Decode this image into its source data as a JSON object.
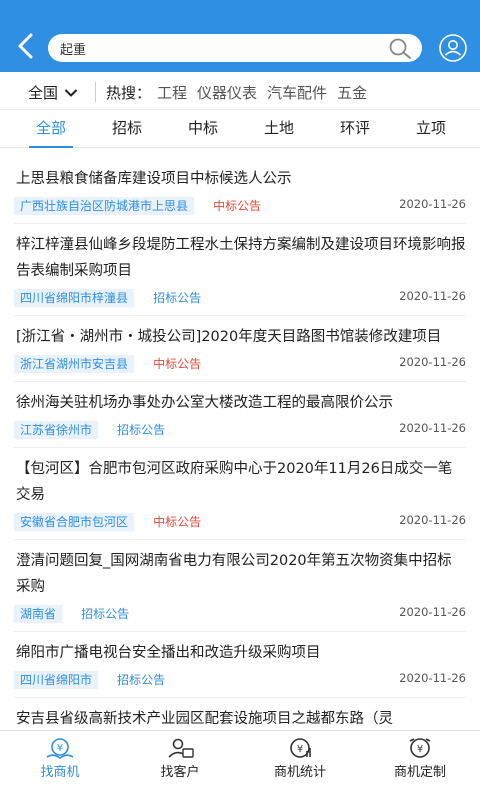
{
  "header": {
    "search_value": "起重",
    "colors": {
      "bar": "#2f8fe3"
    }
  },
  "filter": {
    "region": "全国",
    "hot_label": "热搜：",
    "hot_items": [
      "工程",
      "仪器仪表",
      "汽车配件",
      "五金"
    ]
  },
  "tabs": [
    {
      "label": "全部",
      "active": true
    },
    {
      "label": "招标",
      "active": false
    },
    {
      "label": "中标",
      "active": false
    },
    {
      "label": "土地",
      "active": false
    },
    {
      "label": "环评",
      "active": false
    },
    {
      "label": "立项",
      "active": false
    }
  ],
  "list": [
    {
      "title": "上思县粮食储备库建设项目中标候选人公示",
      "location": "广西壮族自治区防城港市上思县",
      "type": "中标公告",
      "type_kind": "zhong",
      "date": "2020-11-26"
    },
    {
      "title": "梓江梓潼县仙峰乡段堤防工程水土保持方案编制及建设项目环境影响报告表编制采购项目",
      "location": "四川省绵阳市梓潼县",
      "type": "招标公告",
      "type_kind": "zhao",
      "date": "2020-11-26"
    },
    {
      "title": "[浙江省・湖州市・城投公司]2020年度天目路图书馆装修改建项目",
      "location": "浙江省湖州市安吉县",
      "type": "中标公告",
      "type_kind": "zhong",
      "date": "2020-11-26"
    },
    {
      "title": "徐州海关驻机场办事处办公室大楼改造工程的最高限价公示",
      "location": "江苏省徐州市",
      "type": "招标公告",
      "type_kind": "zhao",
      "date": "2020-11-26"
    },
    {
      "title": "【包河区】合肥市包河区政府采购中心于2020年11月26日成交一笔交易",
      "location": "安徽省合肥市包河区",
      "type": "中标公告",
      "type_kind": "zhong",
      "date": "2020-11-26"
    },
    {
      "title": "澄清问题回复_国网湖南省电力有限公司2020年第五次物资集中招标采购",
      "location": "湖南省",
      "type": "招标公告",
      "type_kind": "zhao",
      "date": "2020-11-26"
    },
    {
      "title": "绵阳市广播电视台安全播出和改造升级采购项目",
      "location": "四川省绵阳市",
      "type": "招标公告",
      "type_kind": "zhao",
      "date": "2020-11-26"
    },
    {
      "title": "安吉县省级高新技术产业园区配套设施项目之越都东路（灵",
      "location": "",
      "type": "",
      "type_kind": "",
      "date": ""
    }
  ],
  "bottom_nav": [
    {
      "label": "找商机",
      "icon": "yen-hand-icon",
      "active": true
    },
    {
      "label": "找客户",
      "icon": "customer-icon",
      "active": false
    },
    {
      "label": "商机统计",
      "icon": "stats-icon",
      "active": false
    },
    {
      "label": "商机定制",
      "icon": "custom-icon",
      "active": false
    }
  ]
}
